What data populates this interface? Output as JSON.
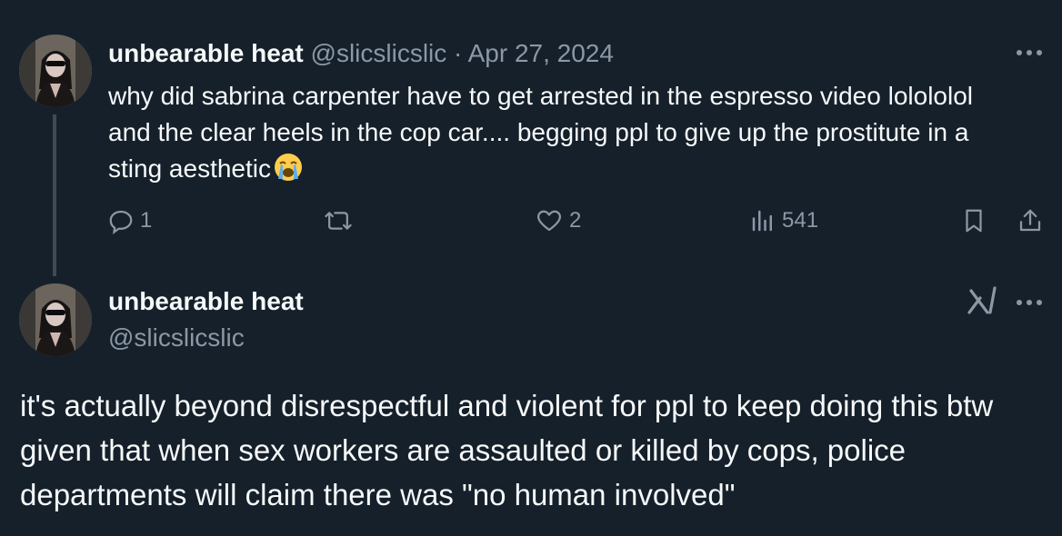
{
  "tweet1": {
    "display_name": "unbearable heat",
    "handle": "@slicslicslic",
    "separator": "·",
    "date": "Apr 27, 2024",
    "text": "why did sabrina carpenter have to get arrested in the espresso video lolololol and the clear heels in the cop car.... begging ppl to give up the prostitute in a sting aesthetic",
    "emoji": "loudly-crying-face",
    "replies": "1",
    "reposts": "",
    "likes": "2",
    "views": "541"
  },
  "tweet2": {
    "display_name": "unbearable heat",
    "handle": "@slicslicslic",
    "text": "it's actually beyond disrespectful and violent for ppl to keep doing this btw given that when sex workers are assaulted or killed by cops, police departments will claim there was \"no human involved\""
  },
  "colors": {
    "background": "#15202b",
    "text_primary": "#f7f9f9",
    "text_secondary": "#8b98a5",
    "thread_line": "#3e4a56"
  }
}
